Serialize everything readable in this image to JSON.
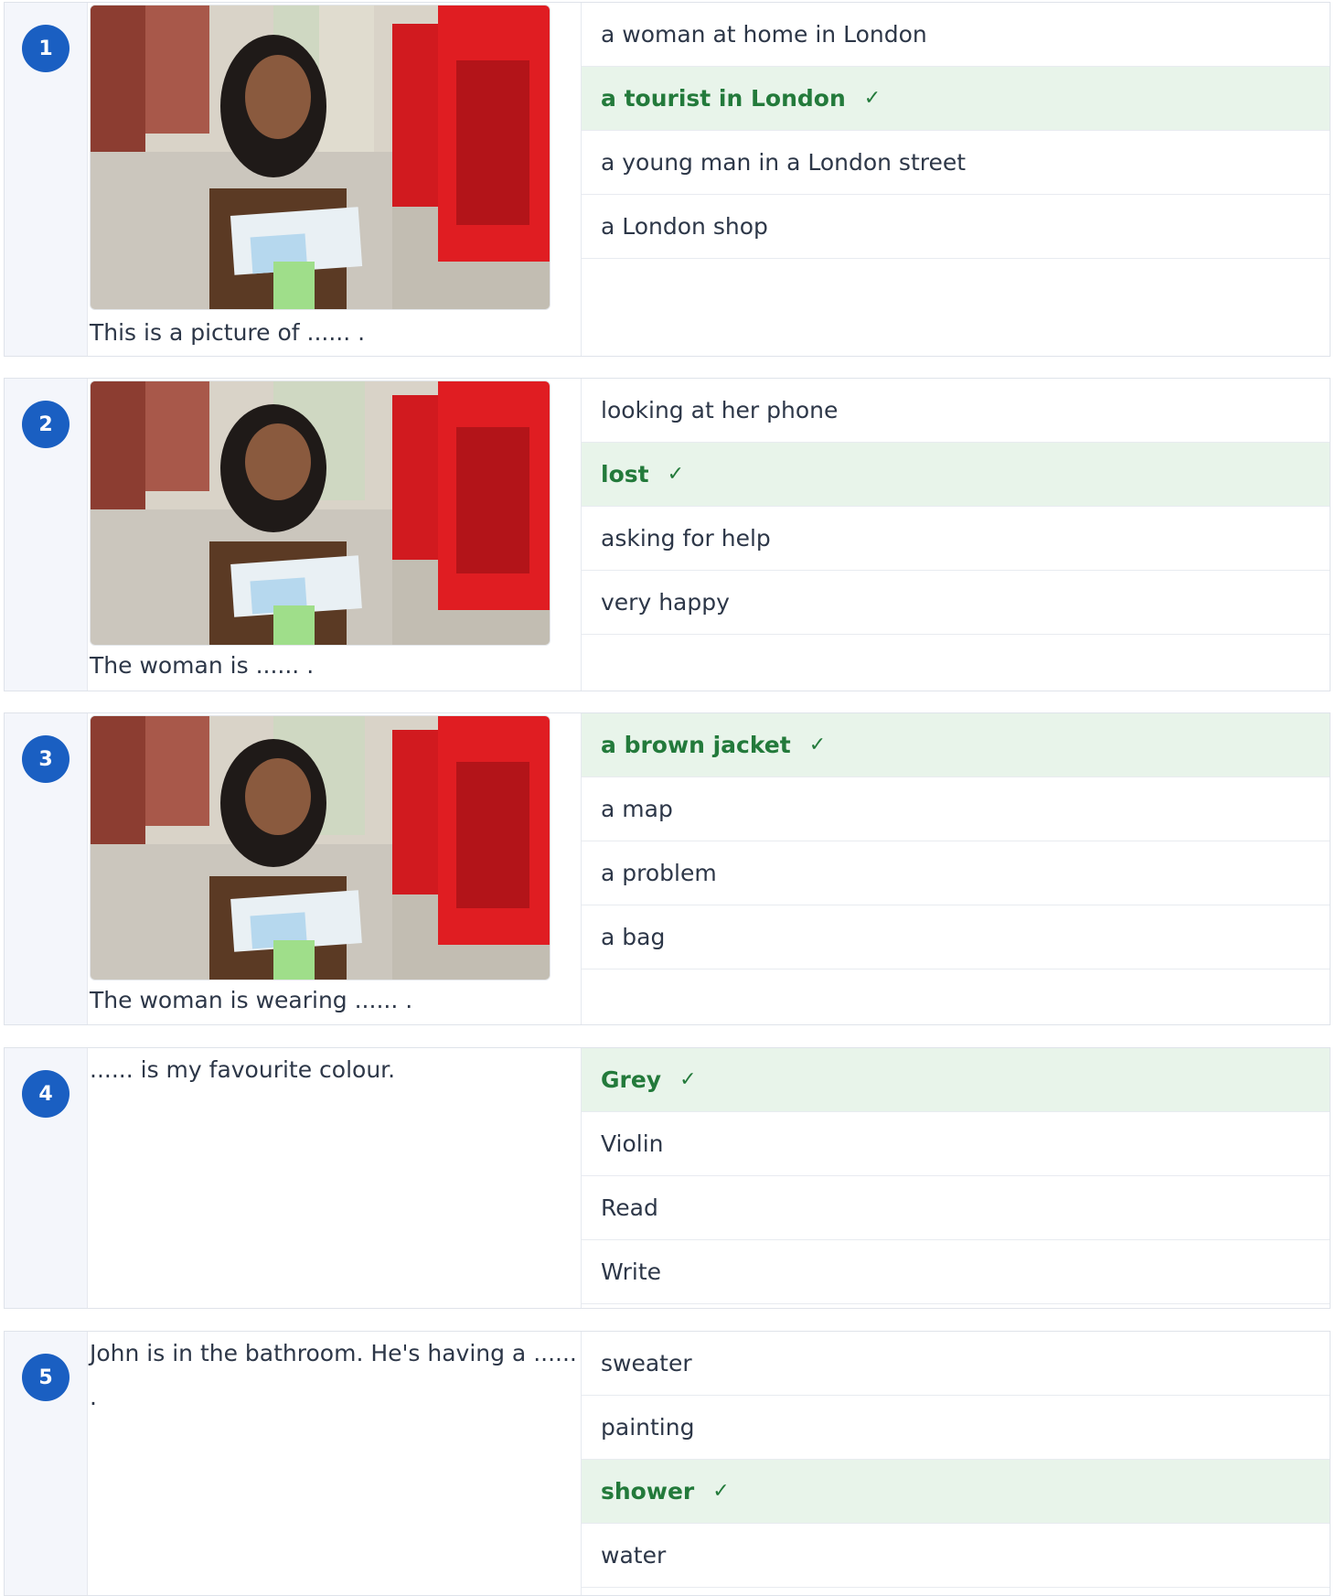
{
  "questions": [
    {
      "number": "1",
      "prompt": "This is a picture of ...... .",
      "has_image": true,
      "options": [
        {
          "label": "a woman at home in London",
          "correct": false
        },
        {
          "label": "a tourist in London",
          "correct": true
        },
        {
          "label": "a young man in a London street",
          "correct": false
        },
        {
          "label": "a London shop",
          "correct": false
        }
      ]
    },
    {
      "number": "2",
      "prompt": "The woman is ...... .",
      "has_image": true,
      "options": [
        {
          "label": "looking at her phone",
          "correct": false
        },
        {
          "label": "lost",
          "correct": true
        },
        {
          "label": "asking for help",
          "correct": false
        },
        {
          "label": "very happy",
          "correct": false
        }
      ]
    },
    {
      "number": "3",
      "prompt": "The woman is wearing ...... .",
      "has_image": true,
      "options": [
        {
          "label": "a brown jacket",
          "correct": true
        },
        {
          "label": "a map",
          "correct": false
        },
        {
          "label": "a problem",
          "correct": false
        },
        {
          "label": "a bag",
          "correct": false
        }
      ]
    },
    {
      "number": "4",
      "prompt": "...... is my favourite colour.",
      "has_image": false,
      "options": [
        {
          "label": "Grey",
          "correct": true
        },
        {
          "label": "Violin",
          "correct": false
        },
        {
          "label": "Read",
          "correct": false
        },
        {
          "label": "Write",
          "correct": false
        }
      ]
    },
    {
      "number": "5",
      "prompt": "John is in the bathroom. He's having a ...... .",
      "has_image": false,
      "options": [
        {
          "label": "sweater",
          "correct": false
        },
        {
          "label": "painting",
          "correct": false
        },
        {
          "label": "shower",
          "correct": true
        },
        {
          "label": "water",
          "correct": false
        }
      ]
    }
  ],
  "check_mark": "✓",
  "colors": {
    "number_badge": "#1a5fc2",
    "correct_bg": "#e8f4ea",
    "correct_text": "#237a3b"
  }
}
